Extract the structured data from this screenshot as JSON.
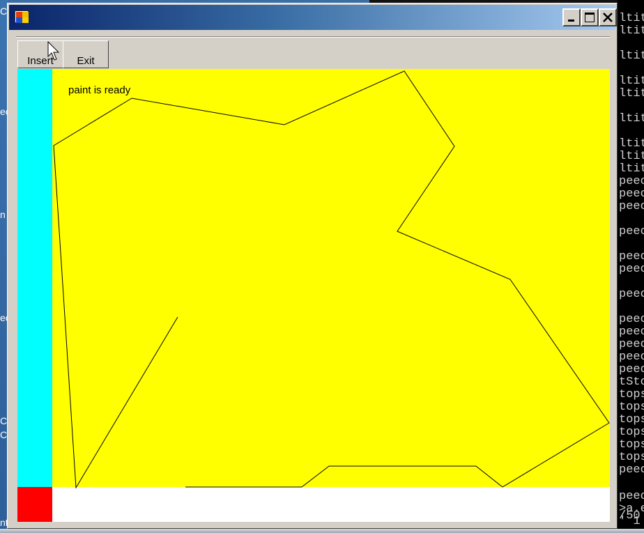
{
  "window": {
    "title": "",
    "controls": [
      "minimize-icon",
      "maximize-icon",
      "close-icon"
    ]
  },
  "toolbar": {
    "insert_label": "Insert",
    "exit_label": "Exit"
  },
  "canvas": {
    "status_text": "paint is ready",
    "colors": {
      "left_panel": "#00ffff",
      "drawing_area": "#ffff00",
      "corner_panel": "#ff0000",
      "bottom_panel": "#ffffff",
      "stroke": "#000000"
    }
  },
  "background": {
    "console_lines": [
      {
        "text": "ltit"
      },
      {
        "text": "ltit"
      },
      {
        "text": "ltit"
      },
      {
        "text": "ltit"
      },
      {
        "text": "ltit"
      },
      {
        "text": "ltit"
      },
      {
        "text": "ltit"
      },
      {
        "text": "ltit"
      },
      {
        "text": "ltit"
      },
      {
        "text": "peec"
      },
      {
        "text": "peec"
      },
      {
        "text": "peec"
      },
      {
        "text": "peec"
      },
      {
        "text": "peec"
      },
      {
        "text": "peec"
      },
      {
        "text": "peec"
      },
      {
        "text": "peec"
      },
      {
        "text": "peec"
      },
      {
        "text": "peec"
      },
      {
        "text": "peec"
      },
      {
        "text": "peec"
      },
      {
        "text": "tSto"
      },
      {
        "text": "tops"
      },
      {
        "text": "tops"
      },
      {
        "text": "tops"
      },
      {
        "text": "tops"
      },
      {
        "text": "tops"
      },
      {
        "text": "tops"
      },
      {
        "text": "peec"
      },
      {
        "text": "peec"
      },
      {
        "text": ">a.e"
      },
      {
        "text": "' 1"
      },
      {
        "text": "/50"
      }
    ],
    "desktop_fragments": [
      "Co",
      "ec",
      "n",
      "ec",
      "C",
      "C",
      "nt"
    ]
  }
}
